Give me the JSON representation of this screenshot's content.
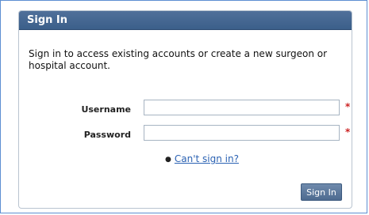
{
  "panel": {
    "title": "Sign In",
    "intro": "Sign in to access existing accounts or create a new surgeon or hospital account."
  },
  "form": {
    "username_label": "Username",
    "password_label": "Password",
    "required_marker": "*",
    "username_value": "",
    "password_value": ""
  },
  "help": {
    "bullet": "●",
    "link_text": "Can't sign in?"
  },
  "actions": {
    "signin_label": "Sign In"
  }
}
